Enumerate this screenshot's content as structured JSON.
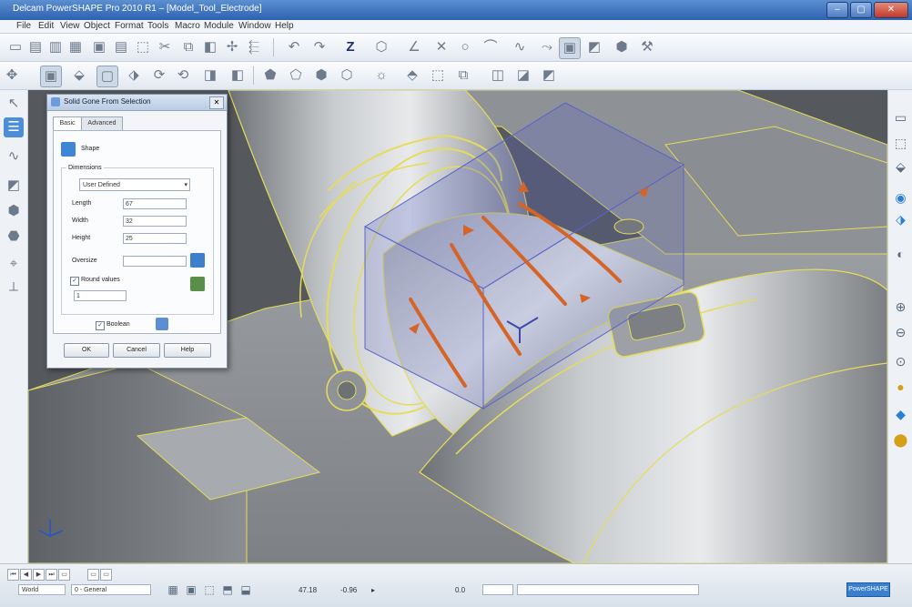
{
  "window": {
    "title": "Delcam PowerSHAPE Pro 2010 R1 – [Model_Tool_Electrode]",
    "controls": [
      "minimize",
      "maximize",
      "close"
    ]
  },
  "menu": [
    "File",
    "Edit",
    "View",
    "Object",
    "Format",
    "Tools",
    "Macro",
    "Module",
    "Window",
    "Help"
  ],
  "dialog": {
    "title": "Solid Gone From Selection",
    "tabs": [
      "Basic",
      "Advanced"
    ],
    "shape_label": "Shape",
    "dimensions_label": "Dimensions",
    "dimensions_mode": "User Defined",
    "length_label": "Length",
    "length_value": "67",
    "width_label": "Width",
    "width_value": "32",
    "height_label": "Height",
    "height_value": "25",
    "oversize_label": "Oversize",
    "oversize_value": "",
    "round_values_label": "Round values",
    "round_values_checked": true,
    "round_value": "1",
    "boolean_label": "Boolean",
    "boolean_checked": true,
    "buttons": {
      "ok": "OK",
      "cancel": "Cancel",
      "help": "Help"
    }
  },
  "status": {
    "workplane": "World",
    "level": "0 - General",
    "coord_x": "47.18",
    "coord_y": "-0.96",
    "coord_z": "0.0",
    "indicator": "PowerSHAPE"
  },
  "colors": {
    "title_bar": "#2d62b0",
    "model_fill": "#9ea2a6",
    "model_outline": "#e5dc5a",
    "selection_box": "#5a63c6",
    "cut_lines": "#d46427",
    "viewport_bg": "#55585c"
  },
  "icons": {
    "toolbar_row1": [
      "new-icon",
      "open-icon",
      "save-icon",
      "print-icon",
      "cut-icon",
      "copy-icon",
      "paste-icon",
      "undo-icon",
      "redo-icon",
      "select-icon",
      "zoom-icon",
      "rotate-icon"
    ],
    "toolbar_row2": [
      "view-top-icon",
      "view-front-icon",
      "view-side-icon",
      "view-iso-icon",
      "shade-icon",
      "wireframe-icon",
      "solid-icon",
      "surface-icon"
    ],
    "left": [
      "pointer-icon",
      "layers-icon",
      "curve-icon",
      "surface-icon",
      "solid-icon",
      "electrode-icon",
      "workplane-icon",
      "measure-icon"
    ],
    "right": [
      "view-icon",
      "cube-icon",
      "front-icon",
      "top-icon",
      "iso-icon",
      "zoom-in-icon",
      "zoom-out-icon",
      "pan-icon",
      "shade-icon",
      "light-icon",
      "solid-view-icon"
    ]
  }
}
